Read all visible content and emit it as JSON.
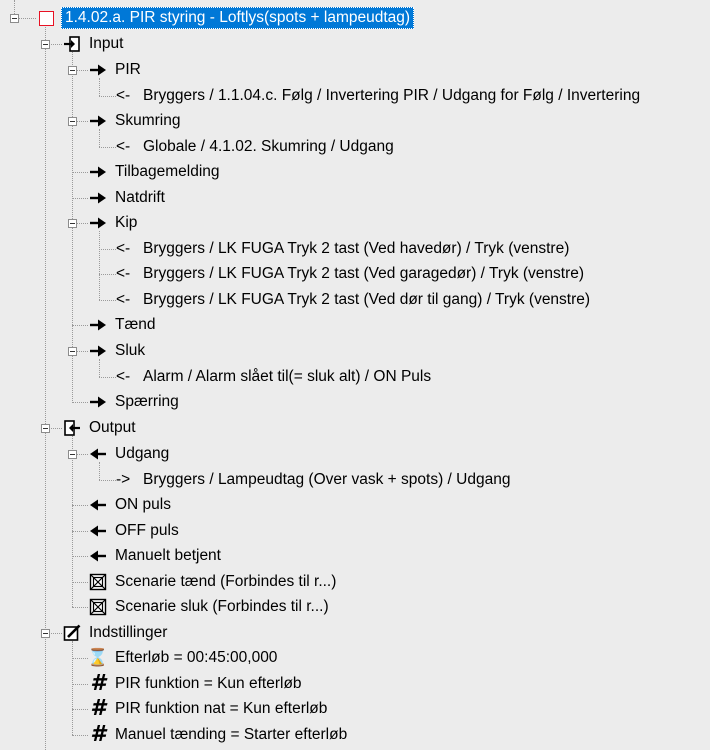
{
  "tree": {
    "root": {
      "label": "1.4.02.a. PIR styring - Loftlys(spots + lampeudtag)",
      "icon": "red-square-icon"
    },
    "input": {
      "label": "Input",
      "pir": {
        "label": "PIR",
        "ref": "Bryggers / 1.1.04.c. Følg / Invertering PIR / Udgang for Følg / Invertering"
      },
      "skumring": {
        "label": "Skumring",
        "ref": "Globale / 4.1.02. Skumring / Udgang"
      },
      "tilbagemelding": {
        "label": "Tilbagemelding"
      },
      "natdrift": {
        "label": "Natdrift"
      },
      "kip": {
        "label": "Kip",
        "refs": [
          "Bryggers / LK FUGA Tryk 2 tast (Ved havedør)  / Tryk (venstre)",
          "Bryggers / LK FUGA Tryk 2 tast (Ved garagedør)  / Tryk (venstre)",
          "Bryggers / LK FUGA Tryk 2 tast (Ved dør til gang)  / Tryk (venstre)"
        ]
      },
      "taend": {
        "label": "Tænd"
      },
      "sluk": {
        "label": "Sluk",
        "ref": "Alarm / Alarm slået til(= sluk alt) / ON Puls"
      },
      "spaerring": {
        "label": "Spærring"
      }
    },
    "output": {
      "label": "Output",
      "udgang": {
        "label": "Udgang",
        "ref": "Bryggers / Lampeudtag (Over vask + spots)  / Udgang"
      },
      "on_puls": {
        "label": "ON puls"
      },
      "off_puls": {
        "label": "OFF puls"
      },
      "manuelt_betjent": {
        "label": "Manuelt betjent"
      },
      "scenarie_taend": {
        "label": "Scenarie tænd (Forbindes til r...)"
      },
      "scenarie_sluk": {
        "label": "Scenarie sluk (Forbindes til r...)"
      }
    },
    "indstillinger": {
      "label": "Indstillinger",
      "efterloeb": {
        "label": "Efterløb = 00:45:00,000"
      },
      "pir_funktion": {
        "label": "PIR funktion = Kun efterløb"
      },
      "pir_funktion_nat": {
        "label": "PIR funktion nat = Kun efterløb"
      },
      "manuel_taending": {
        "label": "Manuel tænding = Starter efterløb"
      }
    },
    "prefixes": {
      "incoming": "<-",
      "outgoing": "->"
    },
    "glyphs": {
      "hourglass": "⌛",
      "hash": "#"
    }
  },
  "colors": {
    "background": "#ececec",
    "selection": "#0078d7",
    "root_icon_border": "#e81123",
    "guide_line": "#9a9a9a"
  }
}
